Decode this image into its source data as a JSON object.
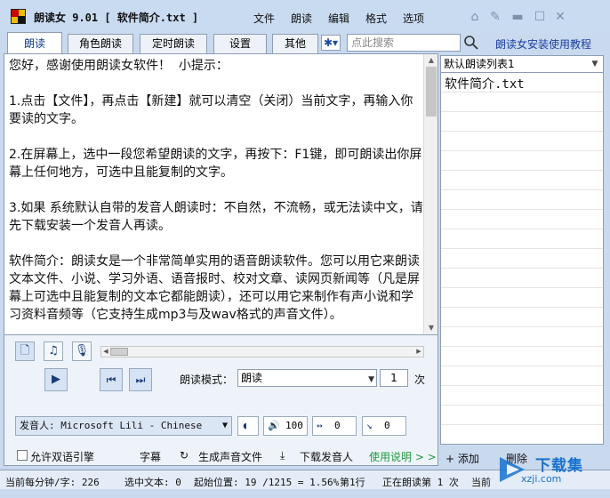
{
  "window": {
    "title": "朗读女 9.01 [ 软件简介.txt ]",
    "menu": [
      "文件",
      "朗读",
      "编辑",
      "格式",
      "选项"
    ],
    "title_buttons": [
      "home-icon",
      "pin-icon",
      "minimize-icon",
      "maximize-icon",
      "close-icon"
    ]
  },
  "tabs": [
    {
      "label": "朗读",
      "active": true
    },
    {
      "label": "角色朗读",
      "active": false
    },
    {
      "label": "定时朗读",
      "active": false
    },
    {
      "label": "设置",
      "active": false
    },
    {
      "label": "其他",
      "active": false
    }
  ],
  "search": {
    "placeholder": "点此搜索"
  },
  "help_link": "朗读女安装使用教程",
  "editor": {
    "text": "您好，感谢使用朗读女软件！  小提示：\n\n1.点击【文件】，再点击【新建】就可以清空（关闭）当前文字，再输入你要读的文字。\n\n2.在屏幕上，选中一段您希望朗读的文字，再按下：F1键，即可朗读出你屏幕上任何地方，可选中且能复制的文字。\n\n3.如果 系统默认自带的发音人朗读时：不自然，不流畅，或无法读中文，请先下载安装一个发音人再读。\n\n软件简介：朗读女是一个非常简单实用的语音朗读软件。您可以用它来朗读文本文件、小说、学习外语、语音报时、校对文章、读网页新闻等（凡是屏幕上可选中且能复制的文本它都能朗读），还可以用它来制作有声小说和学习资料音频等（它支持生成mp3与及wav格式的声音文件）。"
  },
  "playlist": {
    "header": "默认朗读列表1",
    "items": [
      "软件简介.txt"
    ],
    "add": "+ 添加",
    "remove": "删除"
  },
  "controls": {
    "mode_label": "朗读模式：",
    "mode_value": "朗读",
    "repeat_count": "1",
    "repeat_unit": "次",
    "voice_label": "发音人: Microsoft Lili - Chinese",
    "volume": "100",
    "speed": "0",
    "pitch": "0",
    "bilingual": "允许双语引擎",
    "subtitle": "字幕",
    "generate_audio": "生成声音文件",
    "download_voice": "下载发音人",
    "usage_link": "使用说明 > >"
  },
  "status": {
    "speed": "当前每分钟/字: 226",
    "selected": "选中文本: 0",
    "start": "起始位置: 19 /1215 = 1.56%",
    "line": "第1行",
    "reading": "正在朗读第 1 次",
    "current": "当前"
  },
  "watermark": {
    "title": "下载集",
    "sub": "xzji.com"
  },
  "colors": {
    "accent": "#1b3fa3",
    "link_green": "#1e9a3e",
    "window_bg": "#c9dbf1"
  }
}
